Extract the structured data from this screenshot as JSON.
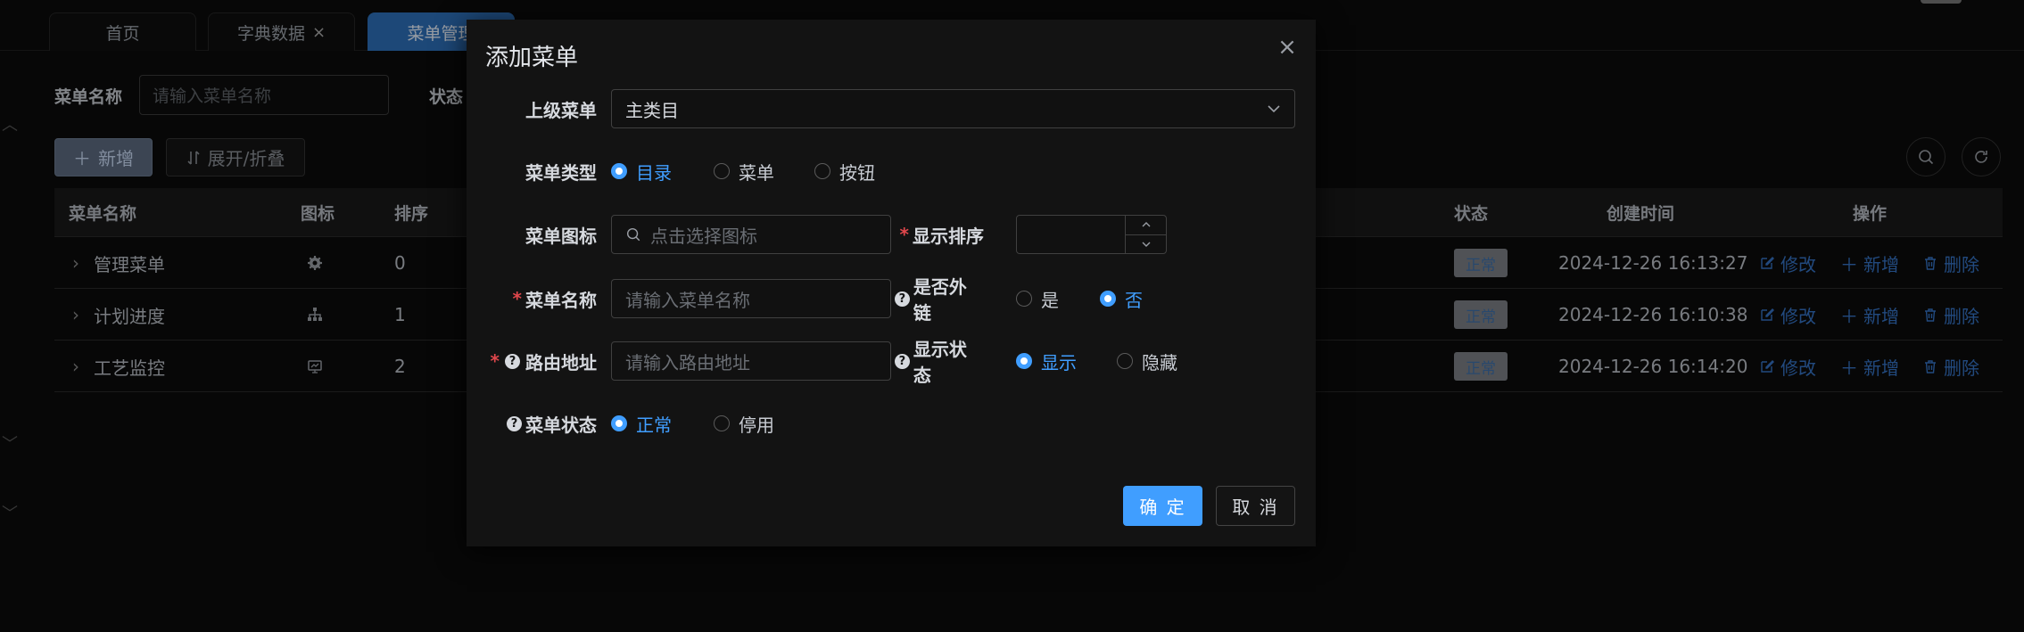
{
  "tabs": [
    {
      "label": "首页"
    },
    {
      "label": "字典数据",
      "closable": "×"
    },
    {
      "label": "菜单管理",
      "active": true
    }
  ],
  "search": {
    "name_label": "菜单名称",
    "name_placeholder": "请输入菜单名称",
    "status_label": "状态"
  },
  "toolbar": {
    "add_label": "新增",
    "expand_label": "展开/折叠"
  },
  "table": {
    "headers": {
      "name": "菜单名称",
      "icon": "图标",
      "order": "排序",
      "status": "状态",
      "created": "创建时间",
      "ops": "操作"
    },
    "rows": [
      {
        "name": "管理菜单",
        "icon": "gear-icon",
        "order": "0",
        "status": "正常",
        "created": "2024-12-26 16:13:27"
      },
      {
        "name": "计划进度",
        "icon": "org-tree-icon",
        "order": "1",
        "status": "正常",
        "created": "2024-12-26 16:10:38"
      },
      {
        "name": "工艺监控",
        "icon": "monitor-icon",
        "order": "2",
        "status": "正常",
        "created": "2024-12-26 16:14:20"
      }
    ],
    "op_edit": "修改",
    "op_add": "新增",
    "op_delete": "删除"
  },
  "dialog": {
    "title": "添加菜单",
    "parent_label": "上级菜单",
    "parent_value": "主类目",
    "type_label": "菜单类型",
    "type_options": [
      "目录",
      "菜单",
      "按钮"
    ],
    "type_selected": "目录",
    "icon_label": "菜单图标",
    "icon_placeholder": "点击选择图标",
    "order_label": "显示排序",
    "order_value": "",
    "name_label": "菜单名称",
    "name_placeholder": "请输入菜单名称",
    "external_label": "是否外链",
    "external_options": [
      "是",
      "否"
    ],
    "external_selected": "否",
    "path_label": "路由地址",
    "path_placeholder": "请输入路由地址",
    "visible_label": "显示状态",
    "visible_options": [
      "显示",
      "隐藏"
    ],
    "visible_selected": "显示",
    "status_label": "菜单状态",
    "status_options": [
      "正常",
      "停用"
    ],
    "status_selected": "正常",
    "ok_label": "确 定",
    "cancel_label": "取 消"
  },
  "colors": {
    "primary": "#409eff",
    "required": "#e0474c",
    "tab_active": "#2d6fb8"
  }
}
